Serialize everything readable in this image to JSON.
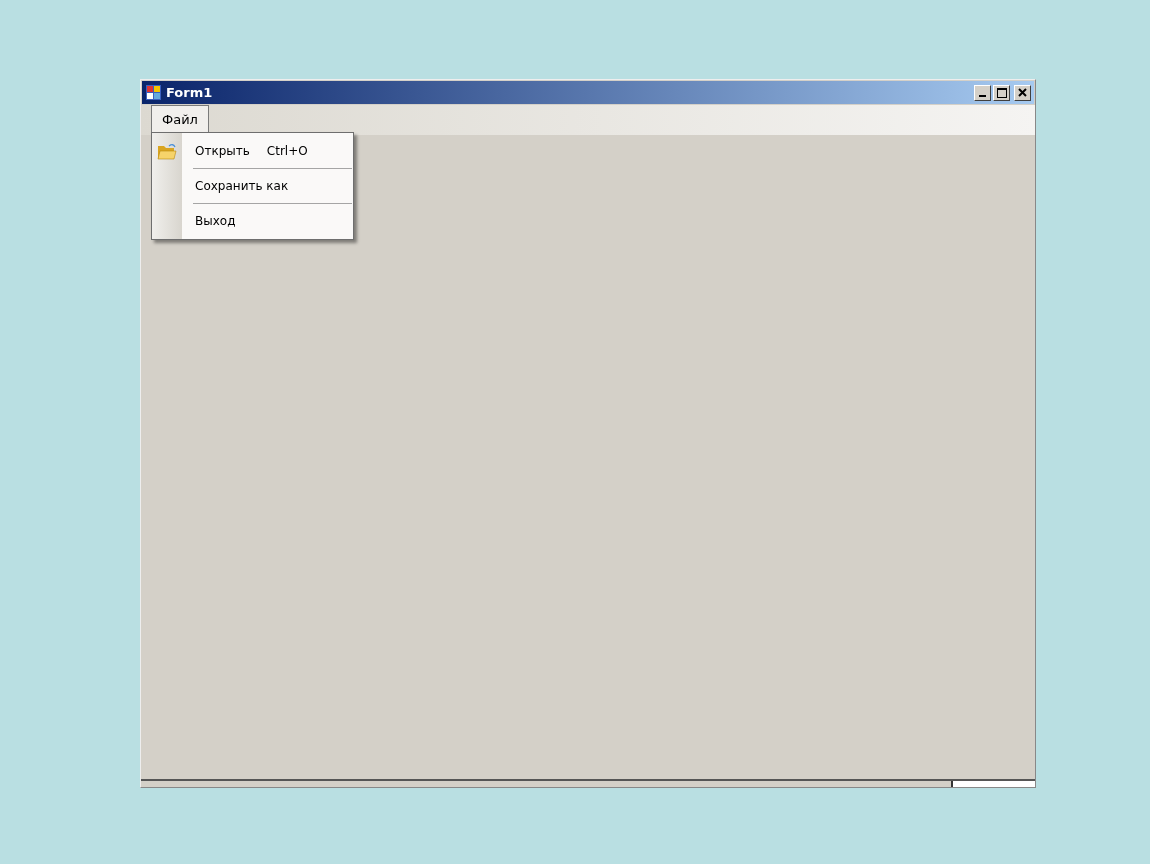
{
  "window": {
    "title": "Form1"
  },
  "menu_bar": [
    {
      "label": "Файл",
      "selected": true
    }
  ],
  "dropdown": [
    {
      "kind": "item",
      "label": "Открыть",
      "shortcut": "Ctrl+O",
      "icon": true
    },
    {
      "kind": "separator"
    },
    {
      "kind": "item",
      "label": "Сохранить как",
      "icon": false
    },
    {
      "kind": "separator"
    },
    {
      "kind": "item",
      "label": "Выход",
      "icon": false
    }
  ]
}
